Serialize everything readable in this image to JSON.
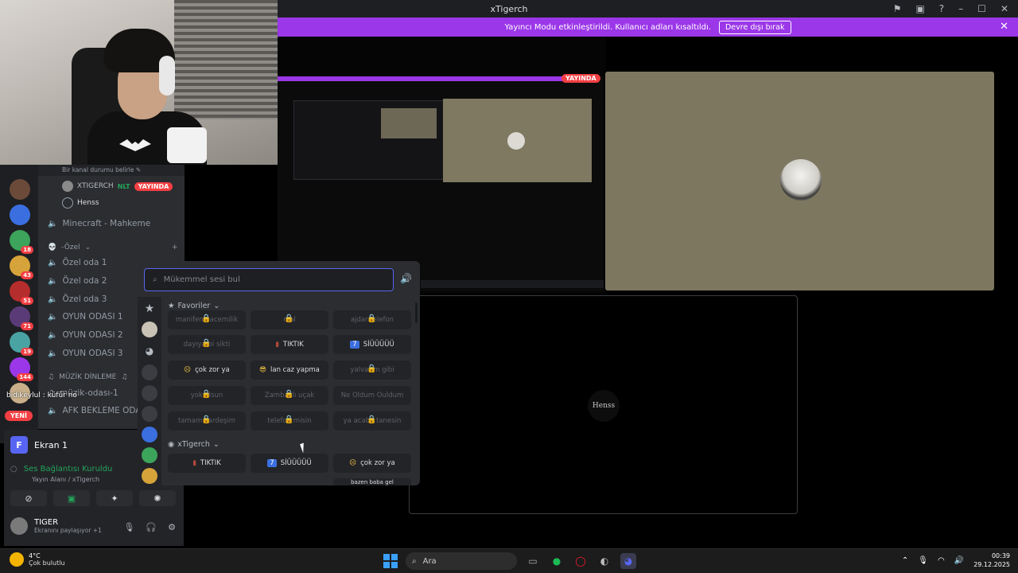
{
  "window": {
    "title": "xTigerch"
  },
  "notice": {
    "text": "Yayıncı Modu etkinleştirildi. Kullanıcı adları kısaltıldı.",
    "button": "Devre dışı bırak"
  },
  "status_bar": {
    "text": "Bir kanal durumu belirle"
  },
  "channels": {
    "live_user": "XTIGERCH",
    "live_tag": "NLT",
    "live_badge": "YAYINDA",
    "user2": "Henss",
    "minecraft": "Minecraft - Mahkeme",
    "ozel_cat": "-Özel",
    "rooms": [
      "Özel oda 1",
      "Özel oda 2",
      "Özel oda 3",
      "OYUN ODASI 1",
      "OYUN ODASI 2",
      "OYUN ODASI 3"
    ],
    "music_cat": "MÜZİK DİNLEME",
    "music_room": "müzik-odası-1",
    "afk": "AFK BEKLEME ODASI"
  },
  "chat": {
    "line": "bidikeylul : küfür no",
    "new_badge": "YENİ"
  },
  "server_badges": [
    "18",
    "43",
    "51",
    "71",
    "19",
    "144"
  ],
  "screen_panel": {
    "title": "Ekran 1",
    "connection": "Ses Bağlantısı Kuruldu",
    "connection_sub": "Yayın Alanı / xTigerch",
    "user": "TIGER",
    "user_status": "Ekranını paylaşıyor +1"
  },
  "soundboard": {
    "search_placeholder": "Mükemmel sesi bul",
    "cat_favorites": "Favoriler",
    "cat_server": "xTigerch",
    "fav_rows": [
      [
        "manifeno acemilik",
        "mal",
        "ajdar telefon"
      ],
      [
        "dayıya bi sikti",
        "TIKTIK",
        "SİÜÜÜÜÜ"
      ],
      [
        "çok zor ya",
        "lan caz yapma",
        "yalvarım gibi"
      ],
      [
        "yok olsun",
        "Zambaklı uçak",
        "Ne Oldum Ouldum"
      ],
      [
        "tamam kardeşim",
        "telefon misin",
        "ya acaba tanesin"
      ]
    ],
    "server_row": [
      "TIKTIK",
      "SİÜÜÜÜÜ",
      "çok zor ya"
    ],
    "partial": "bazen baba gel"
  },
  "share": {
    "live_badge": "YAYINDA",
    "henss_label": "Henss"
  },
  "taskbar": {
    "weather_temp": "4°C",
    "weather_desc": "Çok bulutlu",
    "search": "Ara",
    "time": "00:39",
    "date": "29.12.2025"
  },
  "colors": {
    "accent": "#9b37e8",
    "live": "#f23f43",
    "online": "#23a55a",
    "blurple": "#5865f2"
  }
}
